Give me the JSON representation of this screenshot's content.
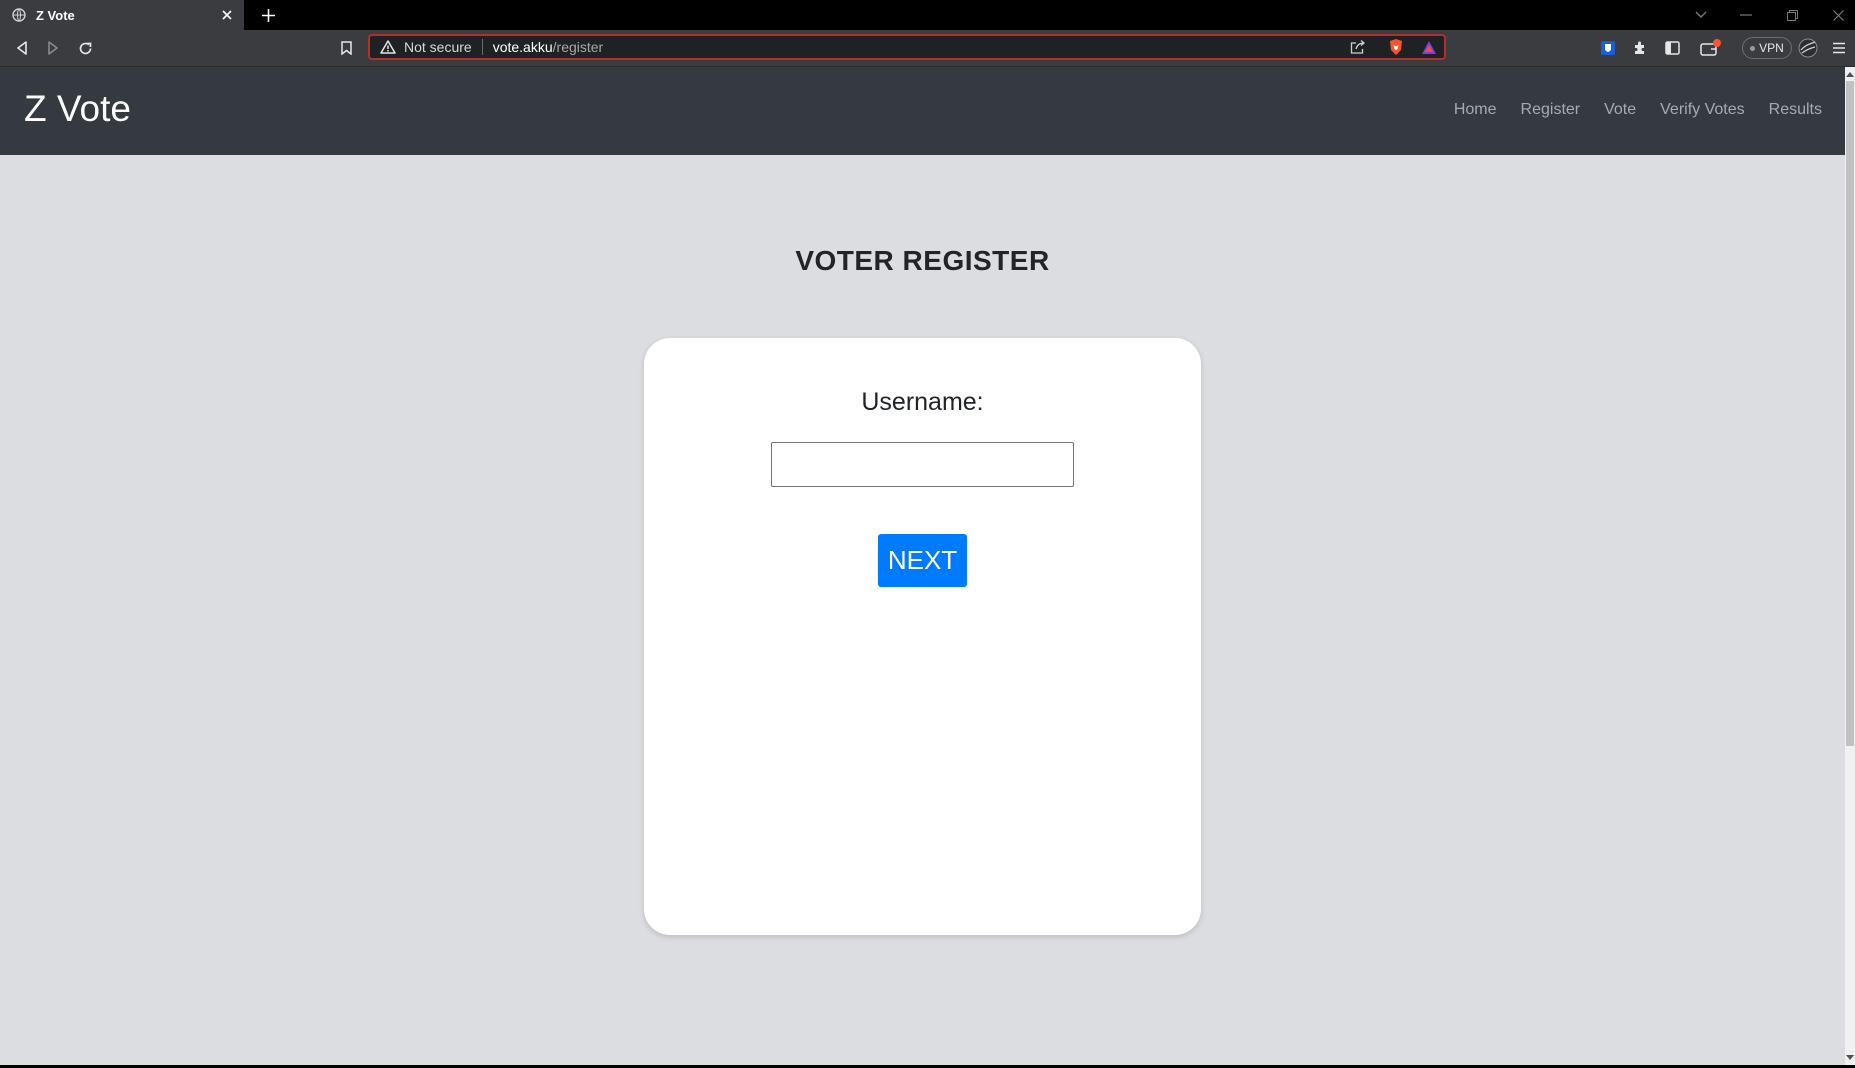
{
  "browser": {
    "tab_title": "Z Vote",
    "security_label": "Not secure",
    "url_host": "vote.akku",
    "url_path": "/register",
    "vpn_label": "VPN"
  },
  "navbar": {
    "brand": "Z Vote",
    "links": [
      "Home",
      "Register",
      "Vote",
      "Verify Votes",
      "Results"
    ]
  },
  "page": {
    "heading": "VOTER REGISTER",
    "username_label": "Username:",
    "username_value": "",
    "next_label": "NEXT"
  },
  "colors": {
    "navbar_bg": "#343a40",
    "page_bg": "#dcdde0",
    "primary_button": "#007bff",
    "omnibox_border": "#b0302a"
  }
}
